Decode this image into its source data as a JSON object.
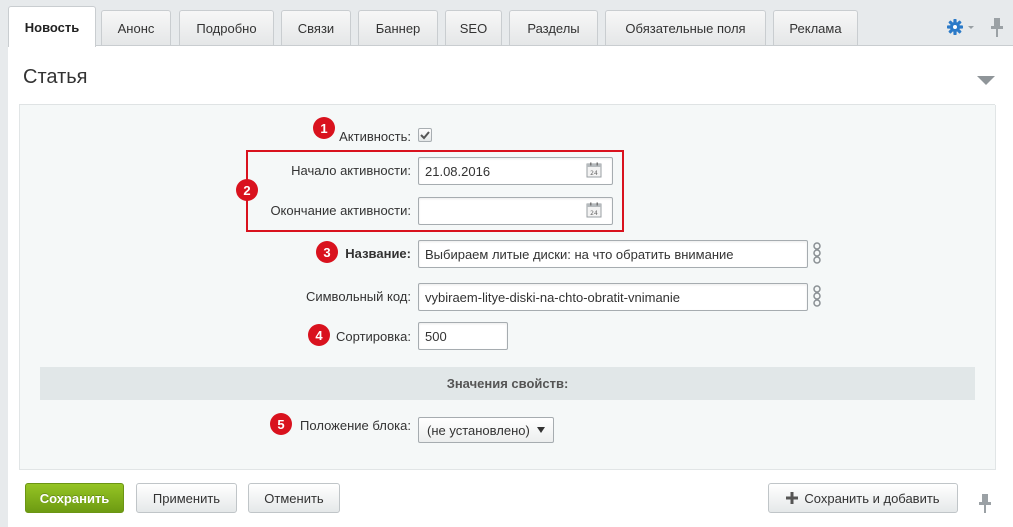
{
  "tabs": [
    {
      "label": "Новость",
      "active": true
    },
    {
      "label": "Анонс"
    },
    {
      "label": "Подробно"
    },
    {
      "label": "Связи"
    },
    {
      "label": "Баннер"
    },
    {
      "label": "SEO"
    },
    {
      "label": "Разделы"
    },
    {
      "label": "Обязательные поля"
    },
    {
      "label": "Реклама"
    }
  ],
  "section": {
    "title": "Статья"
  },
  "fields": {
    "active": {
      "label": "Активность:",
      "checked": true
    },
    "active_from": {
      "label": "Начало активности:",
      "value": "21.08.2016"
    },
    "active_to": {
      "label": "Окончание активности:",
      "value": ""
    },
    "name": {
      "label": "Название:",
      "value": "Выбираем литые диски: на что обратить внимание"
    },
    "code": {
      "label": "Символьный код:",
      "value": "vybiraem-litye-diski-na-chto-obratit-vnimanie"
    },
    "sort": {
      "label": "Сортировка:",
      "value": "500"
    },
    "props_header": "Значения свойств:",
    "block_position": {
      "label": "Положение блока:",
      "value": "(не установлено)"
    }
  },
  "badges": [
    "1",
    "2",
    "3",
    "4",
    "5"
  ],
  "buttons": {
    "save": "Сохранить",
    "apply": "Применить",
    "cancel": "Отменить",
    "save_add": "Сохранить и добавить"
  },
  "colors": {
    "accent_red": "#d9121e",
    "primary_green": "#7aab1a",
    "gear_blue": "#2b7ac8"
  }
}
